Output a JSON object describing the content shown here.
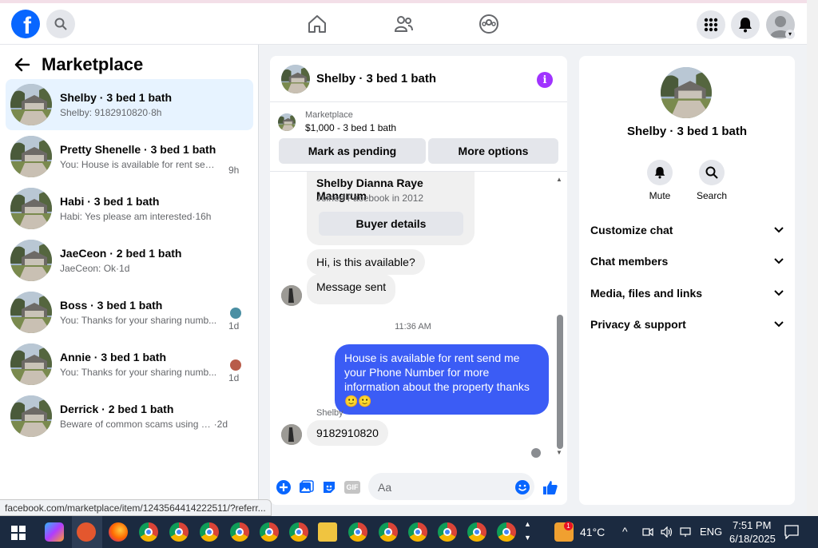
{
  "header": {
    "logo_letter": "f",
    "icons": [
      "search-icon",
      "home-icon",
      "friends-icon",
      "groups-icon",
      "apps-grid-icon",
      "bell-icon",
      "profile-avatar"
    ]
  },
  "sidebar": {
    "title": "Marketplace",
    "conversations": [
      {
        "title": "Shelby · 3 bed 1 bath",
        "preview": "Shelby: 9182910820",
        "time": "8h",
        "active": true
      },
      {
        "title": "Pretty Shenelle · 3 bed 1 bath",
        "preview": "You: House is available for rent send ...",
        "time": "9h"
      },
      {
        "title": "Habi · 3 bed 1 bath",
        "preview": "Habi: Yes please am interested",
        "time": "16h"
      },
      {
        "title": "JaeCeon · 2 bed 1 bath",
        "preview": "JaeCeon: Ok",
        "time": "1d"
      },
      {
        "title": "Boss · 3 bed 1 bath",
        "preview": "You: Thanks for your sharing numb...",
        "time": "1d"
      },
      {
        "title": "Annie · 3 bed 1 bath",
        "preview": "You: Thanks for your sharing numb...",
        "time": "1d"
      },
      {
        "title": "Derrick · 2 bed 1 bath",
        "preview": "Beware of common scams using pay...",
        "time": "2d"
      }
    ]
  },
  "chat": {
    "title": "Shelby · 3 bed 1 bath",
    "info_label": "i",
    "listing_label": "Marketplace",
    "listing_price": "$1,000 - 3 bed 1 bath",
    "mark_pending": "Mark as pending",
    "more_options": "More options",
    "buyer_name": "Shelby Dianna Raye Mangrum",
    "buyer_joined": "Joined Facebook in 2012",
    "buyer_details": "Buyer details",
    "msg1": "Hi, is this available?",
    "msg2": "Message sent",
    "timestamp": "11:36 AM",
    "outgoing": "House is available for rent send me your Phone Number for more information about the property thanks 🙂🙂",
    "sender_label": "Shelby",
    "msg3": "9182910820",
    "input_placeholder": "Aa",
    "gif_label": "GIF"
  },
  "details": {
    "title": "Shelby · 3 bed 1 bath",
    "mute": "Mute",
    "search": "Search",
    "items": [
      "Customize chat",
      "Chat members",
      "Media, files and links",
      "Privacy & support"
    ]
  },
  "status_url": "facebook.com/marketplace/item/1243564414222511/?referr...",
  "taskbar": {
    "temperature": "41°C",
    "lang": "ENG",
    "time": "7:51 PM",
    "date": "6/18/2025",
    "weather_badge": "1"
  },
  "colors": {
    "brand": "#0866ff",
    "outgoing_bubble": "#3b5cf5",
    "info": "#a033ff",
    "active_row": "#e7f3ff"
  }
}
